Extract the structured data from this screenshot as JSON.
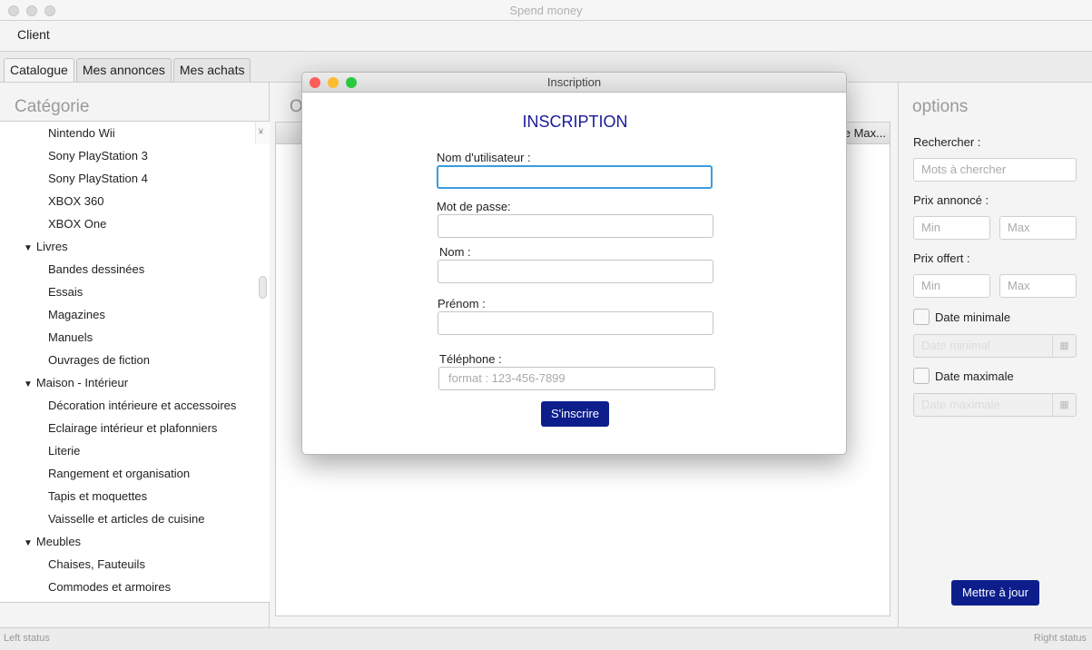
{
  "window": {
    "title": "Spend money"
  },
  "menu": [
    "Client"
  ],
  "tabs": [
    "Catalogue",
    "Mes annonces",
    "Mes achats"
  ],
  "left": {
    "header": "Catégorie",
    "items": [
      {
        "label": "Nintendo Wii",
        "level": 2
      },
      {
        "label": "Sony PlayStation 3",
        "level": 2
      },
      {
        "label": "Sony PlayStation 4",
        "level": 2
      },
      {
        "label": "XBOX 360",
        "level": 2
      },
      {
        "label": "XBOX One",
        "level": 2
      },
      {
        "label": "Livres",
        "level": 1
      },
      {
        "label": "Bandes dessinées",
        "level": 2
      },
      {
        "label": "Essais",
        "level": 2
      },
      {
        "label": "Magazines",
        "level": 2
      },
      {
        "label": "Manuels",
        "level": 2
      },
      {
        "label": "Ouvrages de fiction",
        "level": 2
      },
      {
        "label": "Maison - Intérieur",
        "level": 1
      },
      {
        "label": "Décoration intérieure et accessoires",
        "level": 2
      },
      {
        "label": "Eclairage intérieur et plafonniers",
        "level": 2
      },
      {
        "label": "Literie",
        "level": 2
      },
      {
        "label": "Rangement et organisation",
        "level": 2
      },
      {
        "label": "Tapis et moquettes",
        "level": 2
      },
      {
        "label": "Vaisselle et articles de cuisine",
        "level": 2
      },
      {
        "label": "Meubles",
        "level": 1
      },
      {
        "label": "Chaises, Fauteuils",
        "level": 2
      },
      {
        "label": "Commodes et armoires",
        "level": 2
      }
    ]
  },
  "middle": {
    "header": "O",
    "column": "e Max..."
  },
  "options": {
    "header": "options",
    "search_label": "Rechercher :",
    "search_placeholder": "Mots à chercher",
    "prix_annonce": "Prix annoncé :",
    "prix_offert": "Prix offert :",
    "min": "Min",
    "max": "Max",
    "date_min_label": "Date minimale",
    "date_min_placeholder": "Date minimal",
    "date_max_label": "Date maximale",
    "date_max_placeholder": "Date maximale",
    "update": "Mettre à jour"
  },
  "status": {
    "left": "Left status",
    "right": "Right status"
  },
  "dialog": {
    "title": "Inscription",
    "heading": "INSCRIPTION",
    "username_label": "Nom d'utilisateur :",
    "password_label": "Mot de passe:",
    "nom_label": "Nom :",
    "prenom_label": "Prénom :",
    "tel_label": "Téléphone :",
    "tel_placeholder": "format : 123-456-7899",
    "submit": "S'inscrire"
  }
}
